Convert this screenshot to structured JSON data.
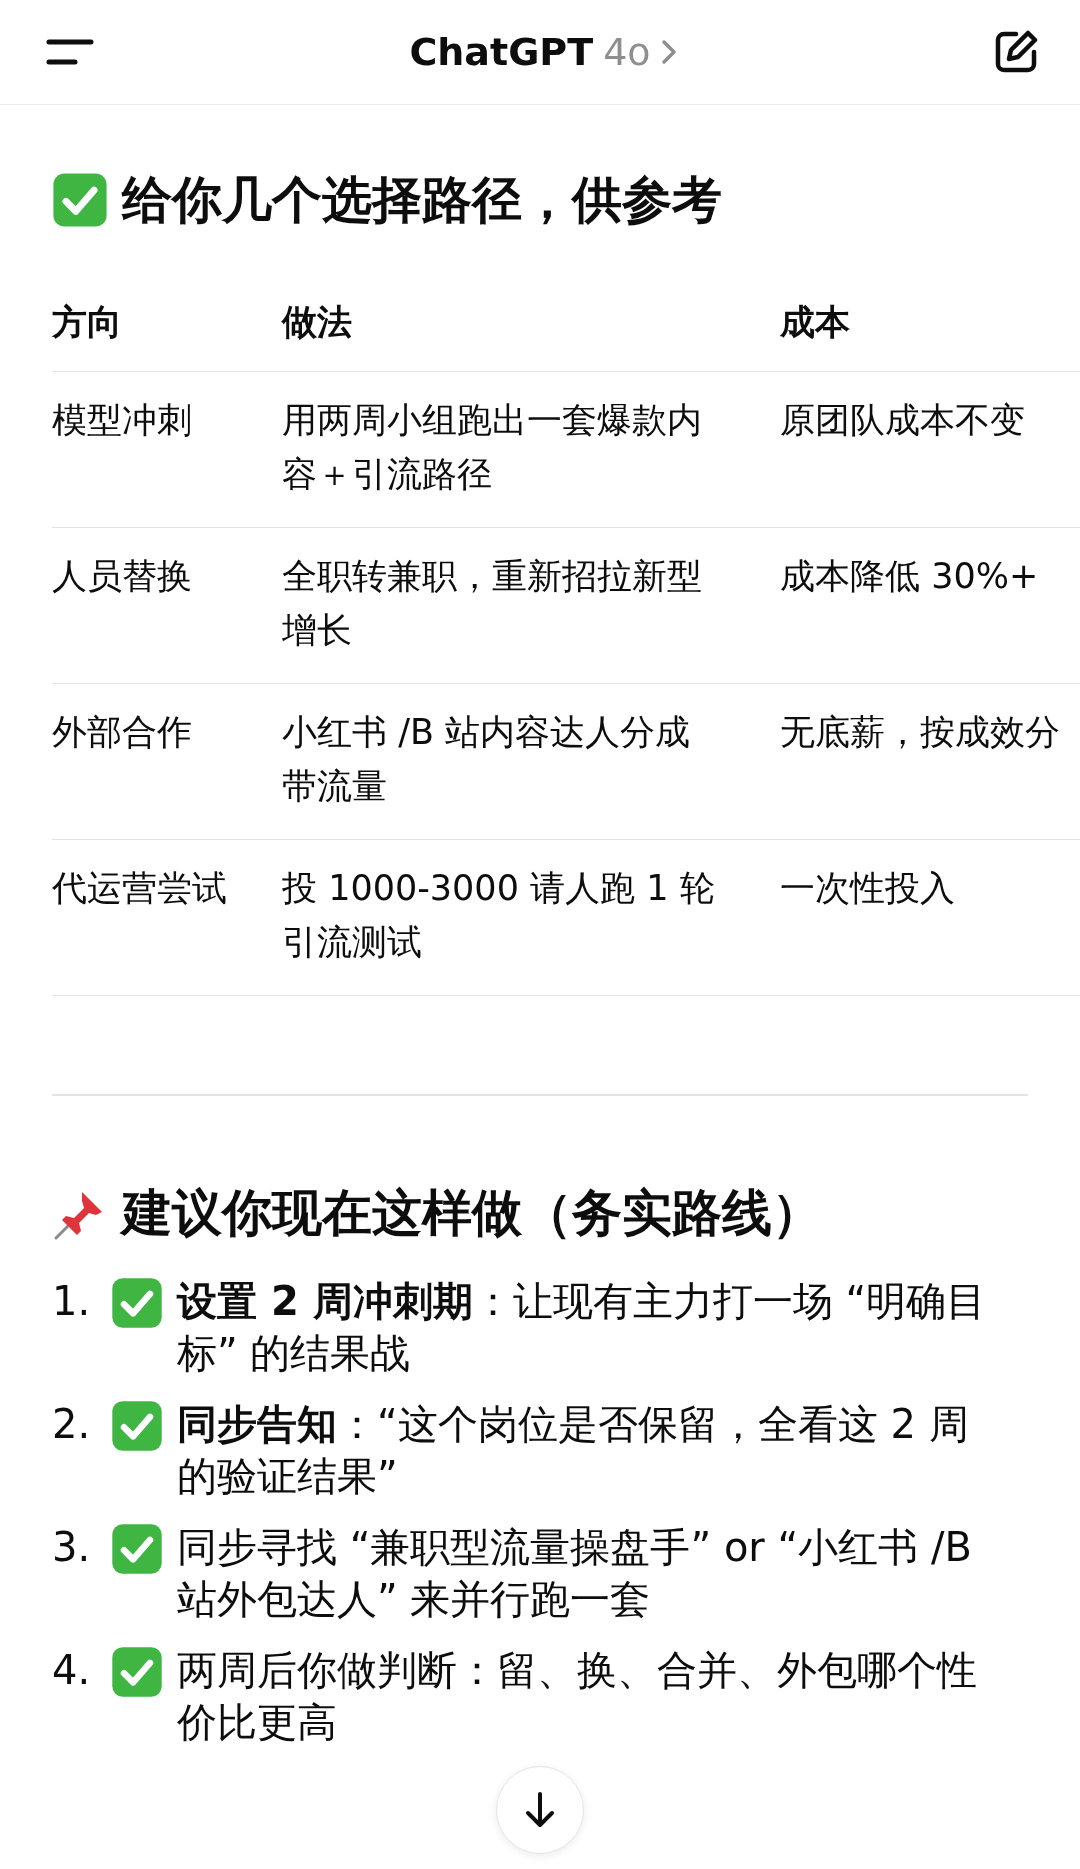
{
  "header": {
    "title": "ChatGPT",
    "model": "4o"
  },
  "section1": {
    "heading": "给你几个选择路径，供参考"
  },
  "table": {
    "columns": [
      "方向",
      "做法",
      "成本"
    ],
    "rows": [
      [
        "模型冲刺",
        "用两周小组跑出一套爆款内容＋引流路径",
        "原团队成本不变"
      ],
      [
        "人员替换",
        "全职转兼职，重新招拉新型增长",
        "成本降低 30%+"
      ],
      [
        "外部合作",
        "小红书 /B 站内容达人分成带流量",
        "无底薪，按成效分"
      ],
      [
        "代运营尝试",
        "投 1000-3000 请人跑 1 轮引流测试",
        "一次性投入"
      ]
    ]
  },
  "section2": {
    "heading": "建议你现在这样做（务实路线）"
  },
  "steps": [
    {
      "number": "1.",
      "text": "**设置 2 周冲刺期**：让现有主力打一场 “明确目标” 的结果战"
    },
    {
      "number": "2.",
      "text": "**同步告知**：“这个岗位是否保留，全看这 2 周的验证结果”"
    },
    {
      "number": "3.",
      "text": "同步寻找 “兼职型流量操盘手” or “小红书 /B 站外包达人” 来并行跑一套"
    },
    {
      "number": "4.",
      "text": "两周后你做判断：留、换、合并、外包哪个性价比更高"
    }
  ]
}
